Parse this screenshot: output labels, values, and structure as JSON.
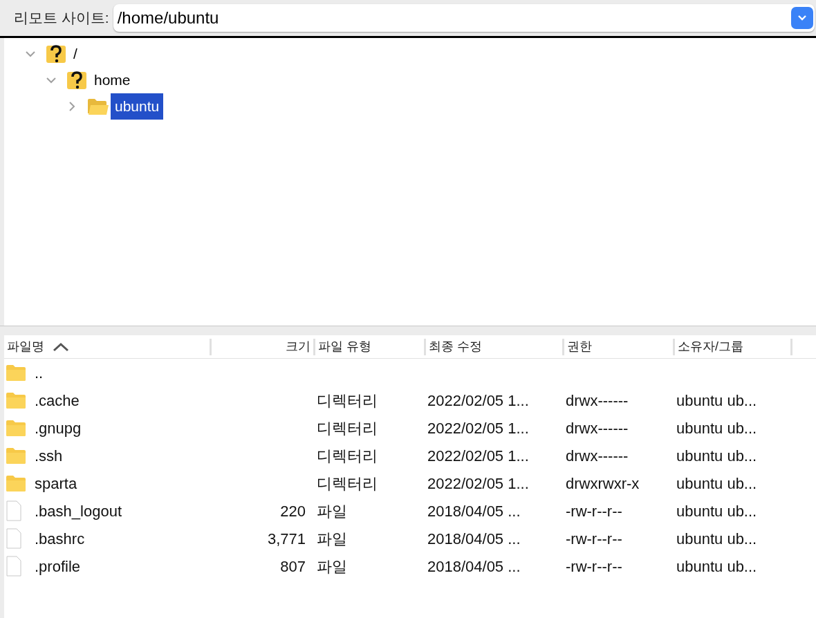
{
  "remote_site": {
    "label": "리모트 사이트:",
    "path": "/home/ubuntu"
  },
  "tree": [
    {
      "label": "/",
      "kind": "unknown",
      "expanded": true,
      "selected": false,
      "children": [
        {
          "label": "home",
          "kind": "unknown",
          "expanded": true,
          "selected": false,
          "children": [
            {
              "label": "ubuntu",
              "kind": "folder",
              "expanded": false,
              "selected": true
            }
          ]
        }
      ]
    }
  ],
  "table": {
    "columns": [
      {
        "label": "파일명",
        "sorted": true
      },
      {
        "label": "크기",
        "sorted": false
      },
      {
        "label": "파일 유형",
        "sorted": false
      },
      {
        "label": "최종 수정",
        "sorted": false
      },
      {
        "label": "권한",
        "sorted": false
      },
      {
        "label": "소유자/그룹",
        "sorted": false
      }
    ],
    "rows": [
      {
        "kind": "folder",
        "name": "..",
        "size": "",
        "type": "",
        "modified": "",
        "permissions": "",
        "owner": ""
      },
      {
        "kind": "folder",
        "name": ".cache",
        "size": "",
        "type": "디렉터리",
        "modified": "2022/02/05 1...",
        "permissions": "drwx------",
        "owner": "ubuntu ub..."
      },
      {
        "kind": "folder",
        "name": ".gnupg",
        "size": "",
        "type": "디렉터리",
        "modified": "2022/02/05 1...",
        "permissions": "drwx------",
        "owner": "ubuntu ub..."
      },
      {
        "kind": "folder",
        "name": ".ssh",
        "size": "",
        "type": "디렉터리",
        "modified": "2022/02/05 1...",
        "permissions": "drwx------",
        "owner": "ubuntu ub..."
      },
      {
        "kind": "folder",
        "name": "sparta",
        "size": "",
        "type": "디렉터리",
        "modified": "2022/02/05 1...",
        "permissions": "drwxrwxr-x",
        "owner": "ubuntu ub..."
      },
      {
        "kind": "file",
        "name": ".bash_logout",
        "size": "220",
        "type": "파일",
        "modified": "2018/04/05 ...",
        "permissions": "-rw-r--r--",
        "owner": "ubuntu ub..."
      },
      {
        "kind": "file",
        "name": ".bashrc",
        "size": "3,771",
        "type": "파일",
        "modified": "2018/04/05 ...",
        "permissions": "-rw-r--r--",
        "owner": "ubuntu ub..."
      },
      {
        "kind": "file",
        "name": ".profile",
        "size": "807",
        "type": "파일",
        "modified": "2018/04/05 ...",
        "permissions": "-rw-r--r--",
        "owner": "ubuntu ub..."
      }
    ]
  }
}
